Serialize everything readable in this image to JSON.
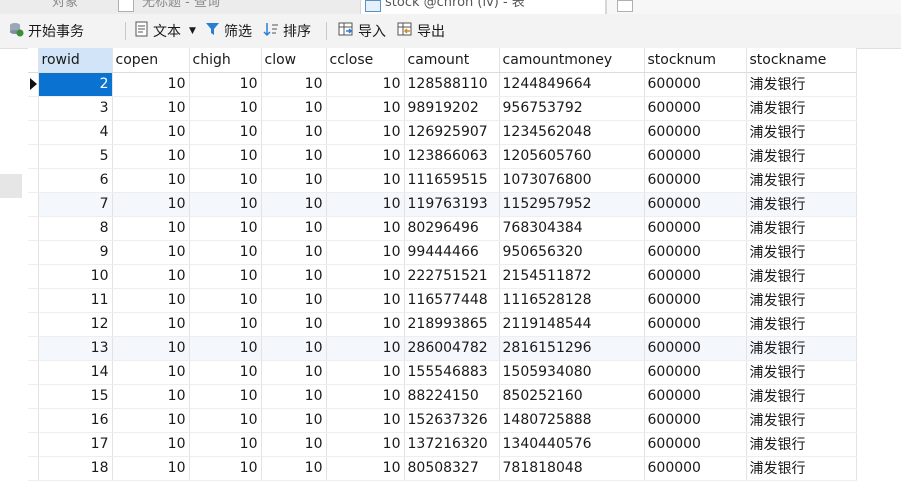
{
  "tabs": [
    {
      "label": "对象"
    },
    {
      "label": "无标题 - 查询"
    },
    {
      "label": "stock @chron (lv) - 表"
    }
  ],
  "toolbar": {
    "begin_transaction": "开始事务",
    "text": "文本",
    "filter": "筛选",
    "sort": "排序",
    "import": "导入",
    "export": "导出"
  },
  "grid": {
    "columns": [
      "rowid",
      "copen",
      "chigh",
      "clow",
      "cclose",
      "camount",
      "camountmoney",
      "stocknum",
      "stockname"
    ],
    "rows": [
      [
        "2",
        "10",
        "10",
        "10",
        "10",
        "128588110",
        "1244849664",
        "600000",
        "浦发银行"
      ],
      [
        "3",
        "10",
        "10",
        "10",
        "10",
        "98919202",
        "956753792",
        "600000",
        "浦发银行"
      ],
      [
        "4",
        "10",
        "10",
        "10",
        "10",
        "126925907",
        "1234562048",
        "600000",
        "浦发银行"
      ],
      [
        "5",
        "10",
        "10",
        "10",
        "10",
        "123866063",
        "1205605760",
        "600000",
        "浦发银行"
      ],
      [
        "6",
        "10",
        "10",
        "10",
        "10",
        "111659515",
        "1073076800",
        "600000",
        "浦发银行"
      ],
      [
        "7",
        "10",
        "10",
        "10",
        "10",
        "119763193",
        "1152957952",
        "600000",
        "浦发银行"
      ],
      [
        "8",
        "10",
        "10",
        "10",
        "10",
        "80296496",
        "768304384",
        "600000",
        "浦发银行"
      ],
      [
        "9",
        "10",
        "10",
        "10",
        "10",
        "99444466",
        "950656320",
        "600000",
        "浦发银行"
      ],
      [
        "10",
        "10",
        "10",
        "10",
        "10",
        "222751521",
        "2154511872",
        "600000",
        "浦发银行"
      ],
      [
        "11",
        "10",
        "10",
        "10",
        "10",
        "116577448",
        "1116528128",
        "600000",
        "浦发银行"
      ],
      [
        "12",
        "10",
        "10",
        "10",
        "10",
        "218993865",
        "2119148544",
        "600000",
        "浦发银行"
      ],
      [
        "13",
        "10",
        "10",
        "10",
        "10",
        "286004782",
        "2816151296",
        "600000",
        "浦发银行"
      ],
      [
        "14",
        "10",
        "10",
        "10",
        "10",
        "155546883",
        "1505934080",
        "600000",
        "浦发银行"
      ],
      [
        "15",
        "10",
        "10",
        "10",
        "10",
        "88224150",
        "850252160",
        "600000",
        "浦发银行"
      ],
      [
        "16",
        "10",
        "10",
        "10",
        "10",
        "152637326",
        "1480725888",
        "600000",
        "浦发银行"
      ],
      [
        "17",
        "10",
        "10",
        "10",
        "10",
        "137216320",
        "1340440576",
        "600000",
        "浦发银行"
      ],
      [
        "18",
        "10",
        "10",
        "10",
        "10",
        "80508327",
        "781818048",
        "600000",
        "浦发银行"
      ]
    ],
    "selected_row": 0,
    "alt_rows": [
      5,
      11
    ]
  },
  "colors": {
    "selection": "#0a72d1",
    "header_selected": "#d2e4f7",
    "alt_row": "#f4f8fd",
    "toolbar_bg": "#f3f3f3"
  }
}
